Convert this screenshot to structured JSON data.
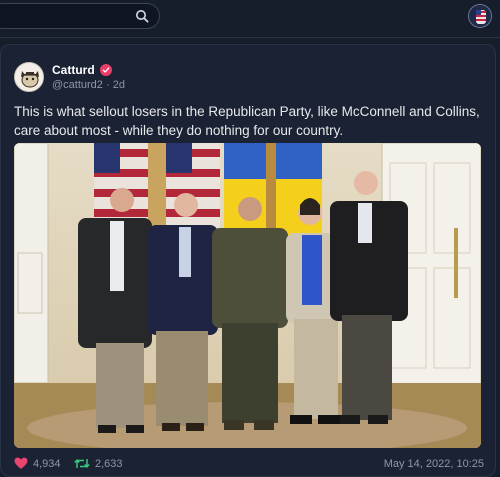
{
  "topbar": {
    "search_placeholder": ""
  },
  "tweet": {
    "author_name": "Catturd",
    "author_handle": "@catturd2",
    "separator": "·",
    "age": "2d",
    "text": "This is what sellout losers in the Republican Party, like McConnell and Collins, care about most - while they do nothing for our country.",
    "likes": "4,934",
    "retweets": "2,633",
    "timestamp": "May 14, 2022, 10:25"
  },
  "colors": {
    "like": "#e8456f",
    "retweet": "#38c77b",
    "verified": "#ea3d67"
  }
}
